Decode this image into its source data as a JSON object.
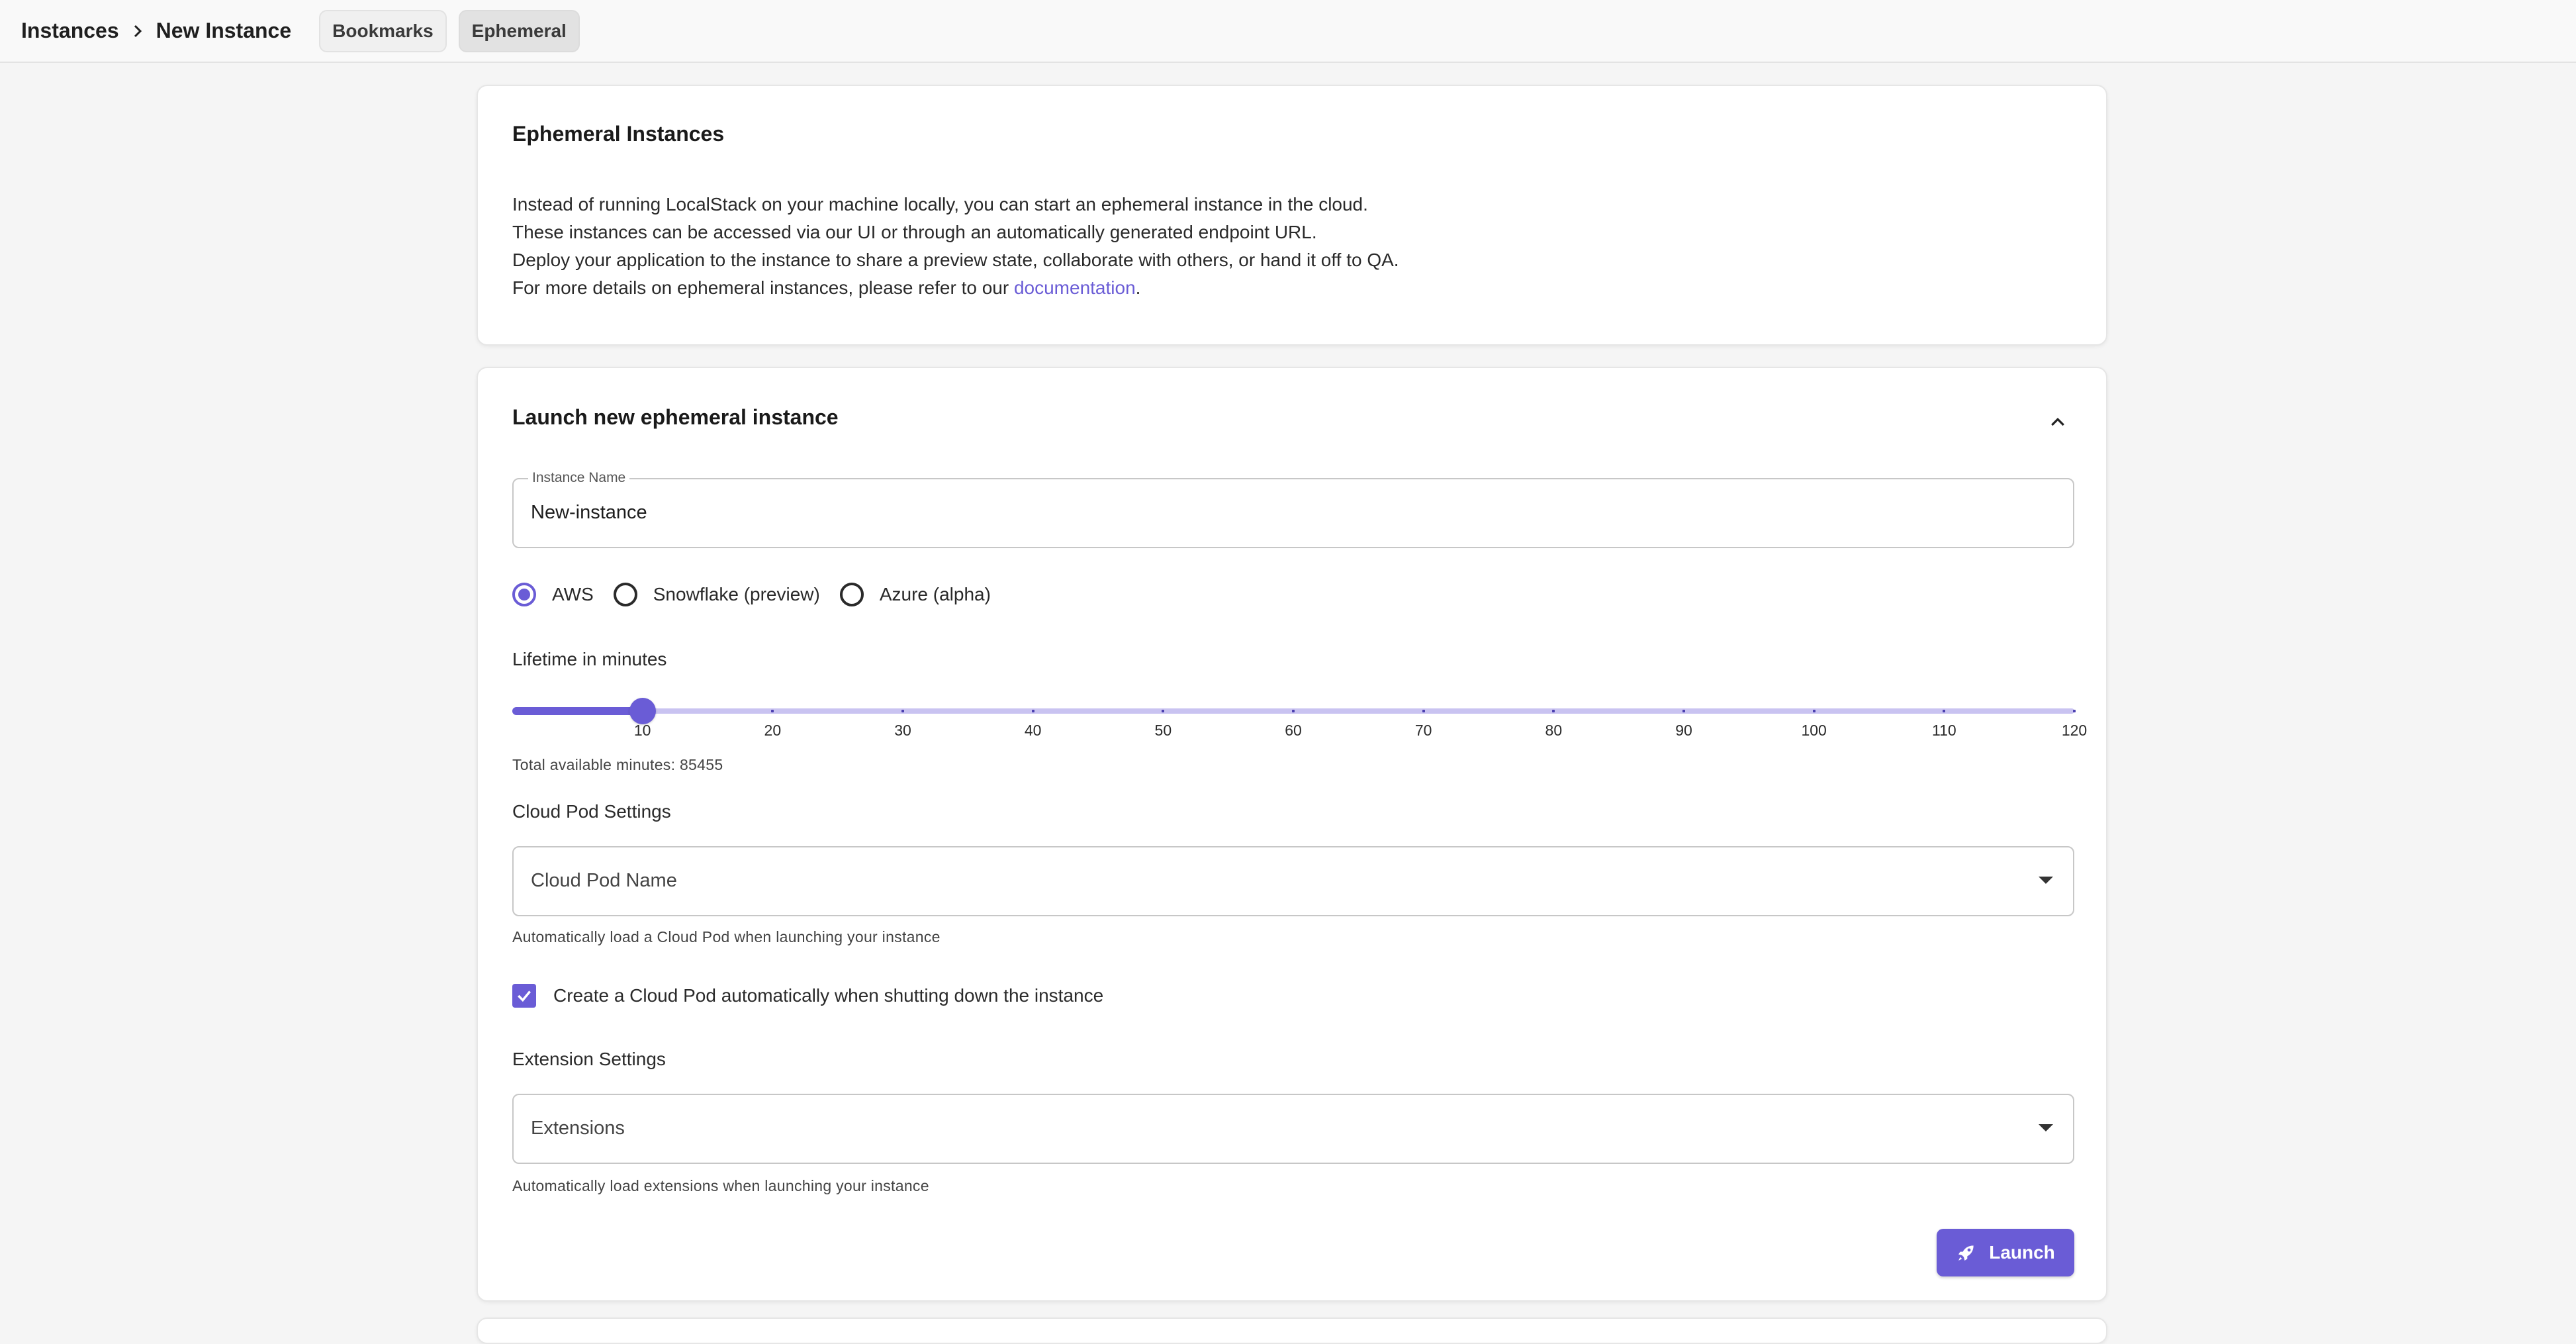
{
  "header": {
    "breadcrumb": [
      "Instances",
      "New Instance"
    ],
    "tabs": [
      {
        "label": "Bookmarks"
      },
      {
        "label": "Ephemeral",
        "active": true
      }
    ]
  },
  "info_card": {
    "title": "Ephemeral Instances",
    "lines": [
      "Instead of running LocalStack on your machine locally, you can start an ephemeral instance in the cloud.",
      "These instances can be accessed via our UI or through an automatically generated endpoint URL.",
      "Deploy your application to the instance to share a preview state, collaborate with others, or hand it off to QA."
    ],
    "last_line_prefix": "For more details on ephemeral instances, please refer to our ",
    "link_text": "documentation",
    "last_line_suffix": "."
  },
  "launch_card": {
    "title": "Launch new ephemeral instance",
    "instance_name": {
      "label": "Instance Name",
      "value": "New-instance"
    },
    "providers": [
      {
        "label": "AWS",
        "selected": true
      },
      {
        "label": "Snowflake (preview)",
        "selected": false
      },
      {
        "label": "Azure (alpha)",
        "selected": false
      }
    ],
    "lifetime": {
      "label": "Lifetime in minutes",
      "value": 10,
      "min": 10,
      "max": 120,
      "ticks": [
        "10",
        "20",
        "30",
        "40",
        "50",
        "60",
        "70",
        "80",
        "90",
        "100",
        "110",
        "120"
      ],
      "available": "Total available minutes: 85455"
    },
    "cloud_pod": {
      "section_label": "Cloud Pod Settings",
      "placeholder": "Cloud Pod Name",
      "helper": "Automatically load a Cloud Pod when launching your instance",
      "auto_create_label": "Create a Cloud Pod automatically when shutting down the instance",
      "auto_create_checked": true
    },
    "extensions": {
      "section_label": "Extension Settings",
      "placeholder": "Extensions",
      "helper": "Automatically load extensions when launching your instance"
    },
    "launch_label": "Launch"
  },
  "colors": {
    "accent": "#6a5cd6",
    "rail": "#c9c3f1"
  }
}
